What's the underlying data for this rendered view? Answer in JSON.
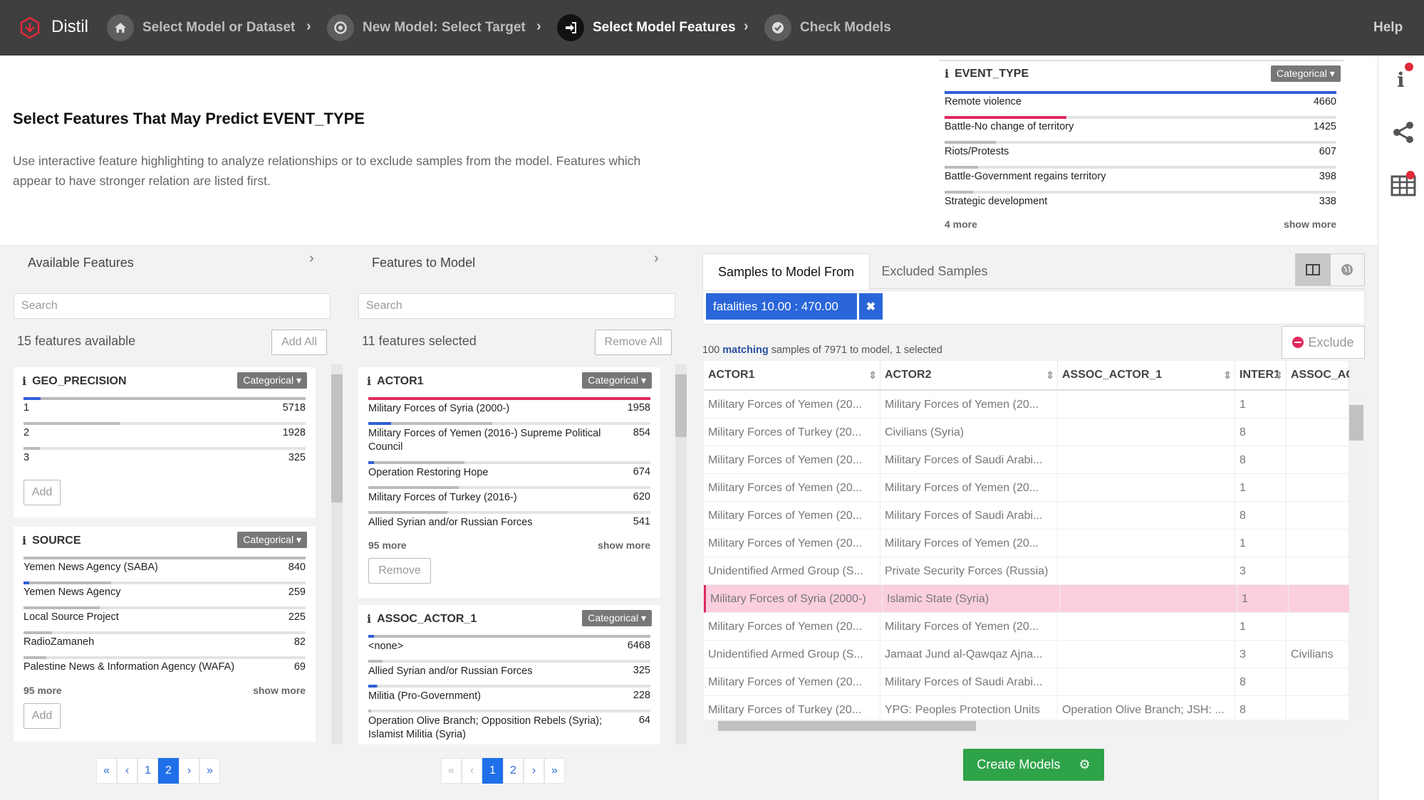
{
  "app": {
    "name": "Distil",
    "help": "Help"
  },
  "breadcrumb": [
    {
      "label": "Select Model or Dataset",
      "icon": "home-icon"
    },
    {
      "label": "New Model: Select Target",
      "icon": "target-icon"
    },
    {
      "label": "Select Model Features",
      "icon": "sign-in-icon"
    },
    {
      "label": "Check Models",
      "icon": "check-circle-icon"
    }
  ],
  "header": {
    "title_prefix": "Select Features That May Predict ",
    "title_target": "EVENT_TYPE",
    "description": "Use interactive feature highlighting to analyze relationships or to exclude samples from the model. Features which appear to have stronger relation are listed first."
  },
  "target_facet": {
    "name": "EVENT_TYPE",
    "type_label": "Categorical",
    "rows": [
      {
        "label": "Remote violence",
        "count": "4660",
        "fraction": 1.0,
        "color": "#2f5fd8"
      },
      {
        "label": "Battle-No change of territory",
        "count": "1425",
        "fraction": 0.31,
        "color": "#e0295e"
      },
      {
        "label": "Riots/Protests",
        "count": "607",
        "fraction": 0.13,
        "color": "#bbbbbb"
      },
      {
        "label": "Battle-Government regains territory",
        "count": "398",
        "fraction": 0.085,
        "color": "#bbbbbb"
      },
      {
        "label": "Strategic development",
        "count": "338",
        "fraction": 0.073,
        "color": "#bbbbbb"
      }
    ],
    "more": "4 more",
    "show_more": "show more"
  },
  "available": {
    "title": "Available Features",
    "search_placeholder": "Search",
    "count_label": "15 features available",
    "add_all": "Add All",
    "facets": [
      {
        "name": "GEO_PRECISION",
        "type_label": "Categorical",
        "add": "Add",
        "rows": [
          {
            "label": "1",
            "count": "5718",
            "fraction": 1.0,
            "hl": 0.06
          },
          {
            "label": "2",
            "count": "1928",
            "fraction": 0.34,
            "hl": 0
          },
          {
            "label": "3",
            "count": "325",
            "fraction": 0.057,
            "hl": 0
          }
        ]
      },
      {
        "name": "SOURCE",
        "type_label": "Categorical",
        "add": "Add",
        "more": "95 more",
        "show_more": "show more",
        "rows": [
          {
            "label": "Yemen News Agency (SABA)",
            "count": "840",
            "fraction": 1.0,
            "hl": 0
          },
          {
            "label": "Yemen News Agency",
            "count": "259",
            "fraction": 0.31,
            "hl": 0.02
          },
          {
            "label": "Local Source Project",
            "count": "225",
            "fraction": 0.27,
            "hl": 0
          },
          {
            "label": "RadioZamaneh",
            "count": "82",
            "fraction": 0.1,
            "hl": 0
          },
          {
            "label": "Palestine News & Information Agency (WAFA)",
            "count": "69",
            "fraction": 0.08,
            "hl": 0
          }
        ]
      }
    ],
    "pager": [
      "«",
      "‹",
      "1",
      "2",
      "›",
      "»"
    ]
  },
  "tomodel": {
    "title": "Features to Model",
    "search_placeholder": "Search",
    "count_label": "11 features selected",
    "remove_all": "Remove All",
    "facets": [
      {
        "name": "ACTOR1",
        "type_label": "Categorical",
        "remove": "Remove",
        "more": "95 more",
        "show_more": "show more",
        "rows": [
          {
            "label": "Military Forces of Syria (2000-)",
            "count": "1958",
            "fraction": 1.0,
            "hl": 0.0,
            "pink": 1.0
          },
          {
            "label": "Military Forces of Yemen (2016-) Supreme Political Council",
            "count": "854",
            "fraction": 0.44,
            "hl": 0.08
          },
          {
            "label": "Operation Restoring Hope",
            "count": "674",
            "fraction": 0.34,
            "hl": 0.02
          },
          {
            "label": "Military Forces of Turkey (2016-)",
            "count": "620",
            "fraction": 0.32,
            "hl": 0
          },
          {
            "label": "Allied Syrian and/or Russian Forces",
            "count": "541",
            "fraction": 0.28,
            "hl": 0
          }
        ]
      },
      {
        "name": "ASSOC_ACTOR_1",
        "type_label": "Categorical",
        "rows": [
          {
            "label": "<none>",
            "count": "6468",
            "fraction": 1.0,
            "hl": 0.02
          },
          {
            "label": "Allied Syrian and/or Russian Forces",
            "count": "325",
            "fraction": 0.05,
            "hl": 0
          },
          {
            "label": "Militia (Pro-Government)",
            "count": "228",
            "fraction": 0.035,
            "hl": 0.03
          },
          {
            "label": "Operation Olive Branch; Opposition Rebels (Syria); Islamist Militia (Syria)",
            "count": "64",
            "fraction": 0.01,
            "hl": 0
          }
        ]
      }
    ],
    "pager": [
      "«",
      "‹",
      "1",
      "2",
      "›",
      "»"
    ]
  },
  "samples": {
    "tab_active": "Samples to Model From",
    "tab_other": "Excluded Samples",
    "filter_chip": "fatalities 10.00 : 470.00",
    "exclude": "Exclude",
    "status_count": "100",
    "status_matching": "matching",
    "status_rest": " samples of 7971 to model, 1 ",
    "status_selected": "selected",
    "columns": [
      "ACTOR1",
      "ACTOR2",
      "ASSOC_ACTOR_1",
      "INTER1",
      "ASSOC_AC"
    ],
    "rows": [
      [
        "Military Forces of Yemen (20...",
        "Military Forces of Yemen (20...",
        "",
        "1",
        ""
      ],
      [
        "Military Forces of Turkey (20...",
        "Civilians (Syria)",
        "",
        "8",
        ""
      ],
      [
        "Military Forces of Yemen (20...",
        "Military Forces of Saudi Arabi...",
        "",
        "8",
        ""
      ],
      [
        "Military Forces of Yemen (20...",
        "Military Forces of Yemen (20...",
        "",
        "1",
        ""
      ],
      [
        "Military Forces of Yemen (20...",
        "Military Forces of Saudi Arabi...",
        "",
        "8",
        ""
      ],
      [
        "Military Forces of Yemen (20...",
        "Military Forces of Yemen (20...",
        "",
        "1",
        ""
      ],
      [
        "Unidentified Armed Group (S...",
        "Private Security Forces (Russia)",
        "",
        "3",
        ""
      ],
      [
        "Military Forces of Syria (2000-)",
        "Islamic State (Syria)",
        "",
        "1",
        ""
      ],
      [
        "Military Forces of Yemen (20...",
        "Military Forces of Yemen (20...",
        "",
        "1",
        ""
      ],
      [
        "Unidentified Armed Group (S...",
        "Jamaat Jund al-Qawqaz Ajna...",
        "",
        "3",
        "Civilians"
      ],
      [
        "Military Forces of Yemen (20...",
        "Military Forces of Saudi Arabi...",
        "",
        "8",
        ""
      ],
      [
        "Military Forces of Turkey (20...",
        "YPG: Peoples Protection Units",
        "Operation Olive Branch; JSH: ...",
        "8",
        ""
      ]
    ],
    "selected_row": 7,
    "create_models": "Create Models"
  },
  "colors": {
    "blue": "#2f5fd8",
    "pink": "#e0295e",
    "green": "#2fa34a",
    "selected_row": "#fbcfe0"
  }
}
